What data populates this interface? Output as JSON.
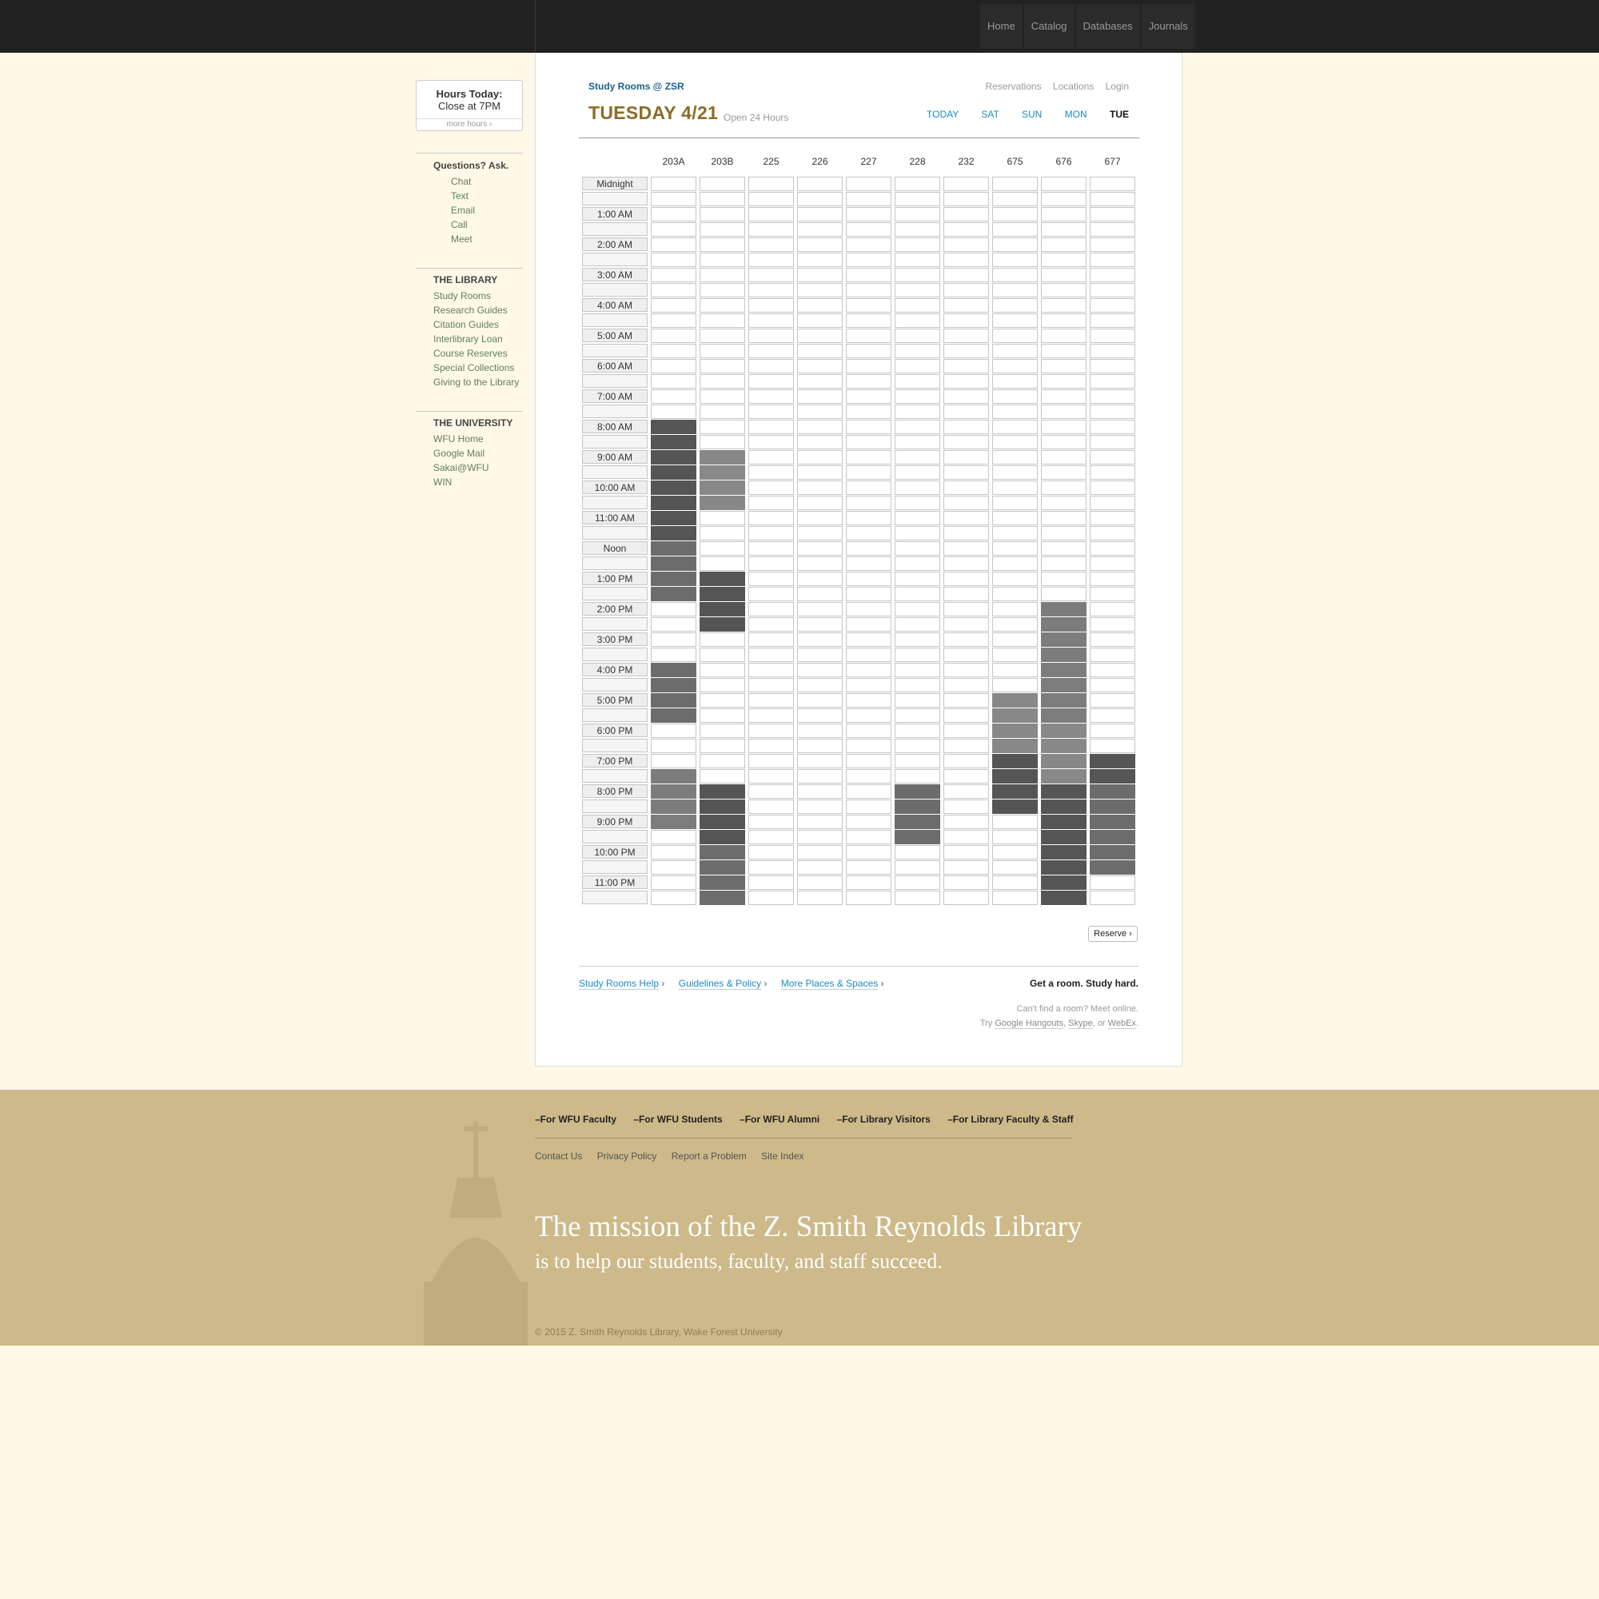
{
  "topnav": [
    "Home",
    "Catalog",
    "Databases",
    "Journals"
  ],
  "sidebar": {
    "hours_title": "Hours Today:",
    "hours_value": "Close at 7PM",
    "more_hours": "more hours ›",
    "ask_title": "Questions? Ask.",
    "ask_items": [
      "Chat",
      "Text",
      "Email",
      "Call",
      "Meet"
    ],
    "library_title": "THE LIBRARY",
    "library_items": [
      "Study Rooms",
      "Research Guides",
      "Citation Guides",
      "Interlibrary Loan",
      "Course Reserves",
      "Special Collections",
      "Giving to the Library"
    ],
    "university_title": "THE UNIVERSITY",
    "university_items": [
      "WFU Home",
      "Google Mail",
      "Sakai@WFU",
      "WIN"
    ]
  },
  "header": {
    "breadcrumb": "Study Rooms @ ZSR",
    "links": [
      "Reservations",
      "Locations",
      "Login"
    ],
    "day_title": "TUESDAY 4/21",
    "open_status": "Open 24 Hours",
    "day_nav": [
      "TODAY",
      "SAT",
      "SUN",
      "MON",
      "TUE"
    ],
    "current_day": "TUE"
  },
  "schedule": {
    "rooms": [
      "203A",
      "203B",
      "225",
      "226",
      "227",
      "228",
      "232",
      "675",
      "676",
      "677"
    ],
    "times": [
      "Midnight",
      "1:00 AM",
      "2:00 AM",
      "3:00 AM",
      "4:00 AM",
      "5:00 AM",
      "6:00 AM",
      "7:00 AM",
      "8:00 AM",
      "9:00 AM",
      "10:00 AM",
      "11:00 AM",
      "Noon",
      "1:00 PM",
      "2:00 PM",
      "3:00 PM",
      "4:00 PM",
      "5:00 PM",
      "6:00 PM",
      "7:00 PM",
      "8:00 PM",
      "9:00 PM",
      "10:00 PM",
      "11:00 PM"
    ],
    "bookings": [
      {
        "room": "203A",
        "start": "8:00 AM",
        "end": "10:00 AM",
        "shade": 1
      },
      {
        "room": "203A",
        "start": "10:00 AM",
        "end": "12:00 PM",
        "shade": 1
      },
      {
        "room": "203A",
        "start": "12:00 PM",
        "end": "2:00 PM",
        "shade": 2
      },
      {
        "room": "203A",
        "start": "4:00 PM",
        "end": "6:00 PM",
        "shade": 2
      },
      {
        "room": "203A",
        "start": "7:30 PM",
        "end": "9:30 PM",
        "shade": 3
      },
      {
        "room": "203B",
        "start": "9:00 AM",
        "end": "11:00 AM",
        "shade": 4
      },
      {
        "room": "203B",
        "start": "1:00 PM",
        "end": "2:00 PM",
        "shade": 1
      },
      {
        "room": "203B",
        "start": "2:00 PM",
        "end": "3:00 PM",
        "shade": 1
      },
      {
        "room": "203B",
        "start": "8:00 PM",
        "end": "10:00 PM",
        "shade": 1
      },
      {
        "room": "203B",
        "start": "10:00 PM",
        "end": "12:00 AM",
        "shade": 2
      },
      {
        "room": "228",
        "start": "8:00 PM",
        "end": "10:00 PM",
        "shade": 2
      },
      {
        "room": "675",
        "start": "5:00 PM",
        "end": "7:00 PM",
        "shade": 4
      },
      {
        "room": "675",
        "start": "7:00 PM",
        "end": "9:00 PM",
        "shade": 1
      },
      {
        "room": "676",
        "start": "2:00 PM",
        "end": "4:00 PM",
        "shade": 3
      },
      {
        "room": "676",
        "start": "4:00 PM",
        "end": "6:00 PM",
        "shade": 3
      },
      {
        "room": "676",
        "start": "6:00 PM",
        "end": "8:00 PM",
        "shade": 4
      },
      {
        "room": "676",
        "start": "8:00 PM",
        "end": "10:00 PM",
        "shade": 1
      },
      {
        "room": "676",
        "start": "10:00 PM",
        "end": "12:00 AM",
        "shade": 1
      },
      {
        "room": "677",
        "start": "7:00 PM",
        "end": "8:00 PM",
        "shade": 1
      },
      {
        "room": "677",
        "start": "8:00 PM",
        "end": "10:00 PM",
        "shade": 2
      },
      {
        "room": "677",
        "start": "10:00 PM",
        "end": "11:00 PM",
        "shade": 2
      }
    ],
    "shade_colors": {
      "1": "#555555",
      "2": "#6c6c6c",
      "3": "#7c7c7c",
      "4": "#888888"
    },
    "reserve_label": "Reserve ›"
  },
  "bottom": {
    "help": "Study Rooms Help",
    "guidelines": "Guidelines & Policy",
    "places": "More Places & Spaces",
    "arrow": "›",
    "tagline": "Get a room. Study hard.",
    "cant_find": "Can't find a room? Meet online.",
    "try": "Try",
    "hangouts": "Google Hangouts",
    "skype": "Skype",
    "or": ", or",
    "webex": "WebEx",
    "period": "."
  },
  "footer": {
    "audiences": [
      "–For WFU Faculty",
      "–For WFU Students",
      "–For WFU Alumni",
      "–For Library Visitors",
      "–For Library Faculty & Staff"
    ],
    "links": [
      "Contact Us",
      "Privacy Policy",
      "Report a Problem",
      "Site Index"
    ],
    "mission_line1": "The mission of the Z. Smith Reynolds Library",
    "mission_line2": "is to help our students, faculty, and staff succeed.",
    "copyright": "© 2015 Z. Smith Reynolds Library, Wake Forest University"
  }
}
